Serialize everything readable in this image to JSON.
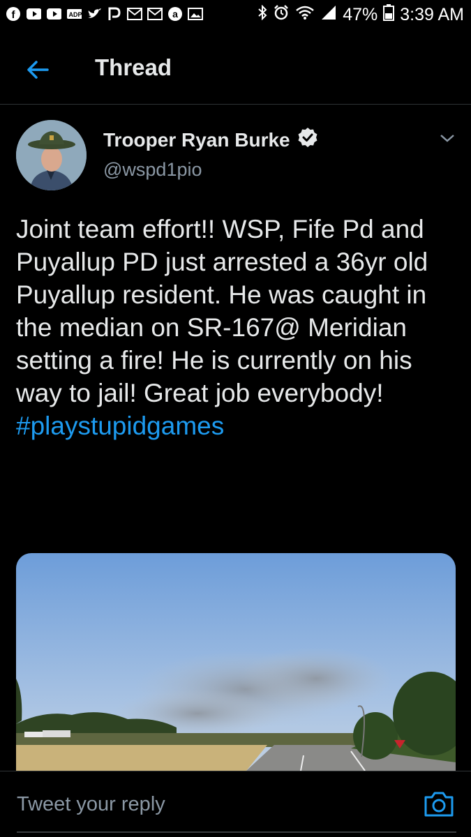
{
  "status_bar": {
    "battery": "47%",
    "time": "3:39 AM",
    "notification_icons": [
      "facebook-icon",
      "youtube-icon",
      "youtube-icon",
      "adp-icon",
      "twitter-icon",
      "pandora-icon",
      "gmail-icon",
      "gmail-icon",
      "amazon-icon",
      "gallery-icon"
    ]
  },
  "header": {
    "title": "Thread"
  },
  "tweet": {
    "author_name": "Trooper Ryan Burke",
    "handle": "@wspd1pio",
    "verified": true,
    "text": "Joint team effort!! WSP, Fife Pd and Puyallup PD just arrested a 36yr old Puyallup resident. He was caught in the median on SR-167@ Meridian setting a fire! He is currently on his way to jail! Great job everybody!",
    "hashtag": "#playstupidgames"
  },
  "reply": {
    "placeholder": "Tweet your reply"
  },
  "colors": {
    "accent": "#1d9bf0",
    "background": "#000000",
    "muted": "#8b98a5"
  }
}
